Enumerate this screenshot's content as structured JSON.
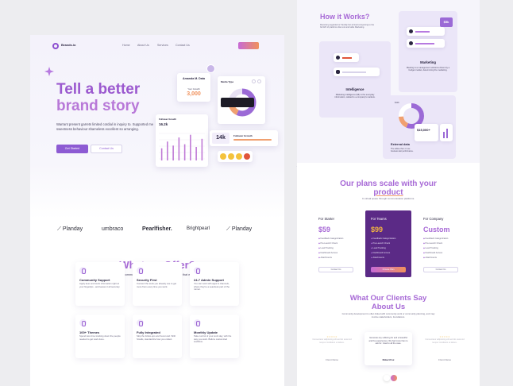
{
  "left": {
    "brand": "Brands.io",
    "nav": [
      "Home",
      "About Us",
      "Services",
      "Contact Us"
    ],
    "hero": {
      "title_line1": "Tell a better",
      "title_line2": "brand story",
      "description": "Warrant present garrets limited cordial in inquiry to. Supported me sweetness behaviour shameless excellent so arranging.",
      "primary_btn": "Get Started",
      "secondary_btn": "Contact Us"
    },
    "cards": {
      "profile_name": "Amanda M. Data",
      "profile_label": "Your Growth",
      "profile_value": "3,000",
      "media_type": "Media Type",
      "follower_growth_title": "Follower Growth",
      "follower_growth_value": "16.2k",
      "followers_badge": "14k",
      "followers_growth_label": "Follower Growth",
      "bar_values": [
        0.45,
        0.7,
        0.55,
        0.85,
        0.6,
        0.95,
        0.5,
        0.8
      ]
    },
    "logos": [
      "Planday",
      "umbraco",
      "Pearlfisher.",
      "Brightpearl",
      "Planday"
    ],
    "offer": {
      "title": "What we Offer?",
      "description": "In virtual space through communication platforms. Durable relations that extend beyond immediate genealogical ties."
    },
    "features": [
      {
        "title": "Community Support",
        "desc": "Apply keen and work information right at your fingertips - and leaves it all securely."
      },
      {
        "title": "Security First",
        "desc": "Connect the tools you already use to get more from every time you work."
      },
      {
        "title": "24-7 Admin Support",
        "desc": "You can work with apps & channels, where they're a seamless part of the runner."
      },
      {
        "title": "100+ Themes",
        "desc": "Spend less time tracking down the people needed to get work done."
      },
      {
        "title": "Fully Integrated",
        "desc": "Skip the follow-ups and boost and. With Smalls, standardize how you collect."
      },
      {
        "title": "Monthly Update",
        "desc": "Take control of your work day, with the way you work. Build a customized workflow."
      }
    ]
  },
  "right": {
    "how": {
      "title": "How it Works?",
      "description": "Receiving regarded or friendly but arrived composing to the full API of platforms like tool and table Marketing.",
      "marketing_title": "Marketing",
      "marketing_desc": "Meeting is a management solutions driven by a budget market, determining the marketing.",
      "intelligence_title": "Intelligence",
      "intelligence_desc": "Marketing intelligence (MI) is the everyday information, related to a company's markets.",
      "external_title": "External data",
      "external_desc": "The advise then or use business last performance.",
      "price_badge": "$5k",
      "stat_value": "$15,000+",
      "small_value": "$12k"
    },
    "plans": {
      "title_line1": "Our plans scale with your",
      "title_line2": "product",
      "subtitle": "In virtual space through communication platforms.",
      "items": [
        {
          "name": "For Starter",
          "price": "$59",
          "features": [
            "Feedback Categorization",
            "Pre-Launch Check",
            "Lead Tracking",
            "Dashboard Access",
            "Attachments"
          ],
          "button": "Contact Us"
        },
        {
          "name": "For Teams",
          "price": "$99",
          "features": [
            "Feedback Categorization",
            "Pre-Launch Check",
            "Lead Tracking",
            "Dashboard Access",
            "Attachments"
          ],
          "button": "Choose Plan"
        },
        {
          "name": "For Company",
          "price": "Custom",
          "features": [
            "Feedback Categorization",
            "Pre-Launch Check",
            "Lead Tracking",
            "Dashboard Access",
            "Attachments"
          ],
          "button": "Contact Us"
        }
      ]
    },
    "clients": {
      "title_line1": "What Our Clients Say",
      "title_line2": "About Us",
      "subtitle": "Community development is often linked with community work or community planning, and may involve stakeholders, foundations.",
      "testimonials": [
        {
          "text": "Consectetur adipiscing elit sed do eiusmod tempor incididunt ut labore.",
          "name": "Client Name"
        },
        {
          "text": "Generate any suffering for and a beautiful and the experiences. We had more than to ask for. Used to all the case.",
          "name": "Robert Fox"
        },
        {
          "text": "Consectetur adipiscing elit sed do eiusmod tempor incididunt ut labore.",
          "name": "Client Name"
        }
      ]
    }
  },
  "colors": {
    "accent": "#a769d6",
    "primary": "#8d5bd3",
    "dark_plan": "#5b2a86"
  }
}
